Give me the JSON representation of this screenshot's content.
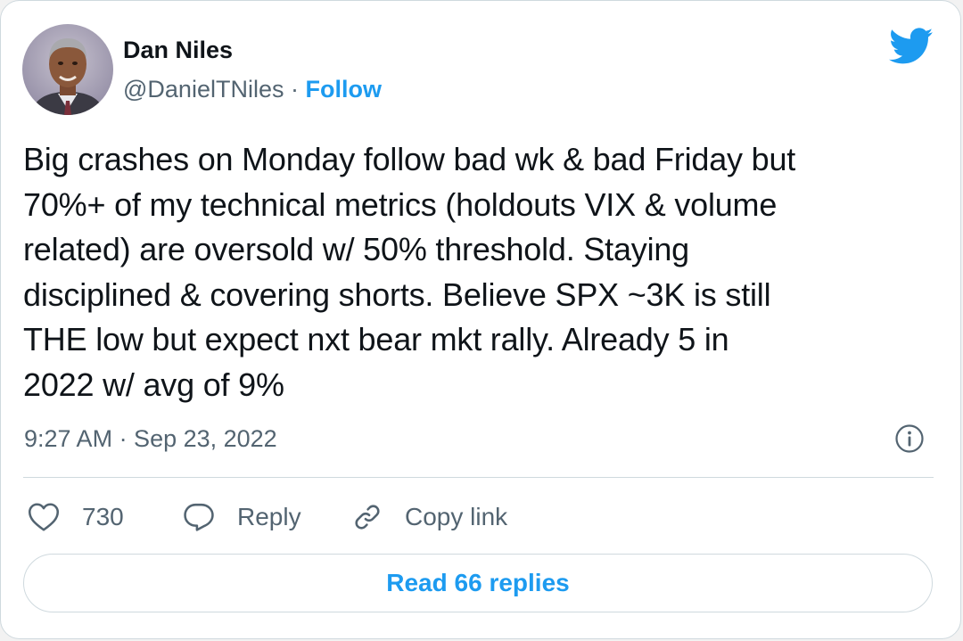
{
  "author": {
    "name": "Dan Niles",
    "handle": "@DanielTNiles",
    "separator": " · ",
    "follow_label": "Follow"
  },
  "tweet": {
    "lines": [
      "Big crashes on Monday follow bad wk & bad Friday but",
      "70%+ of my technical metrics (holdouts VIX & volume",
      "related) are oversold w/ 50% threshold. Staying",
      "disciplined & covering shorts. Believe SPX ~3K is still",
      "THE low but expect nxt bear mkt rally. Already 5 in",
      "2022 w/ avg of 9%"
    ],
    "timestamp": "9:27 AM · Sep 23, 2022"
  },
  "actions": {
    "likes_count": "730",
    "reply_label": "Reply",
    "copy_link_label": "Copy link"
  },
  "read_replies_label": "Read 66 replies",
  "icons": {
    "brand": "twitter-bird-icon",
    "info": "info-icon",
    "like": "heart-icon",
    "reply": "speech-bubble-icon",
    "copy": "link-icon"
  },
  "colors": {
    "accent": "#1d9bf0",
    "text": "#0f1419",
    "secondary_text": "#536471",
    "border": "#cfd9de"
  }
}
